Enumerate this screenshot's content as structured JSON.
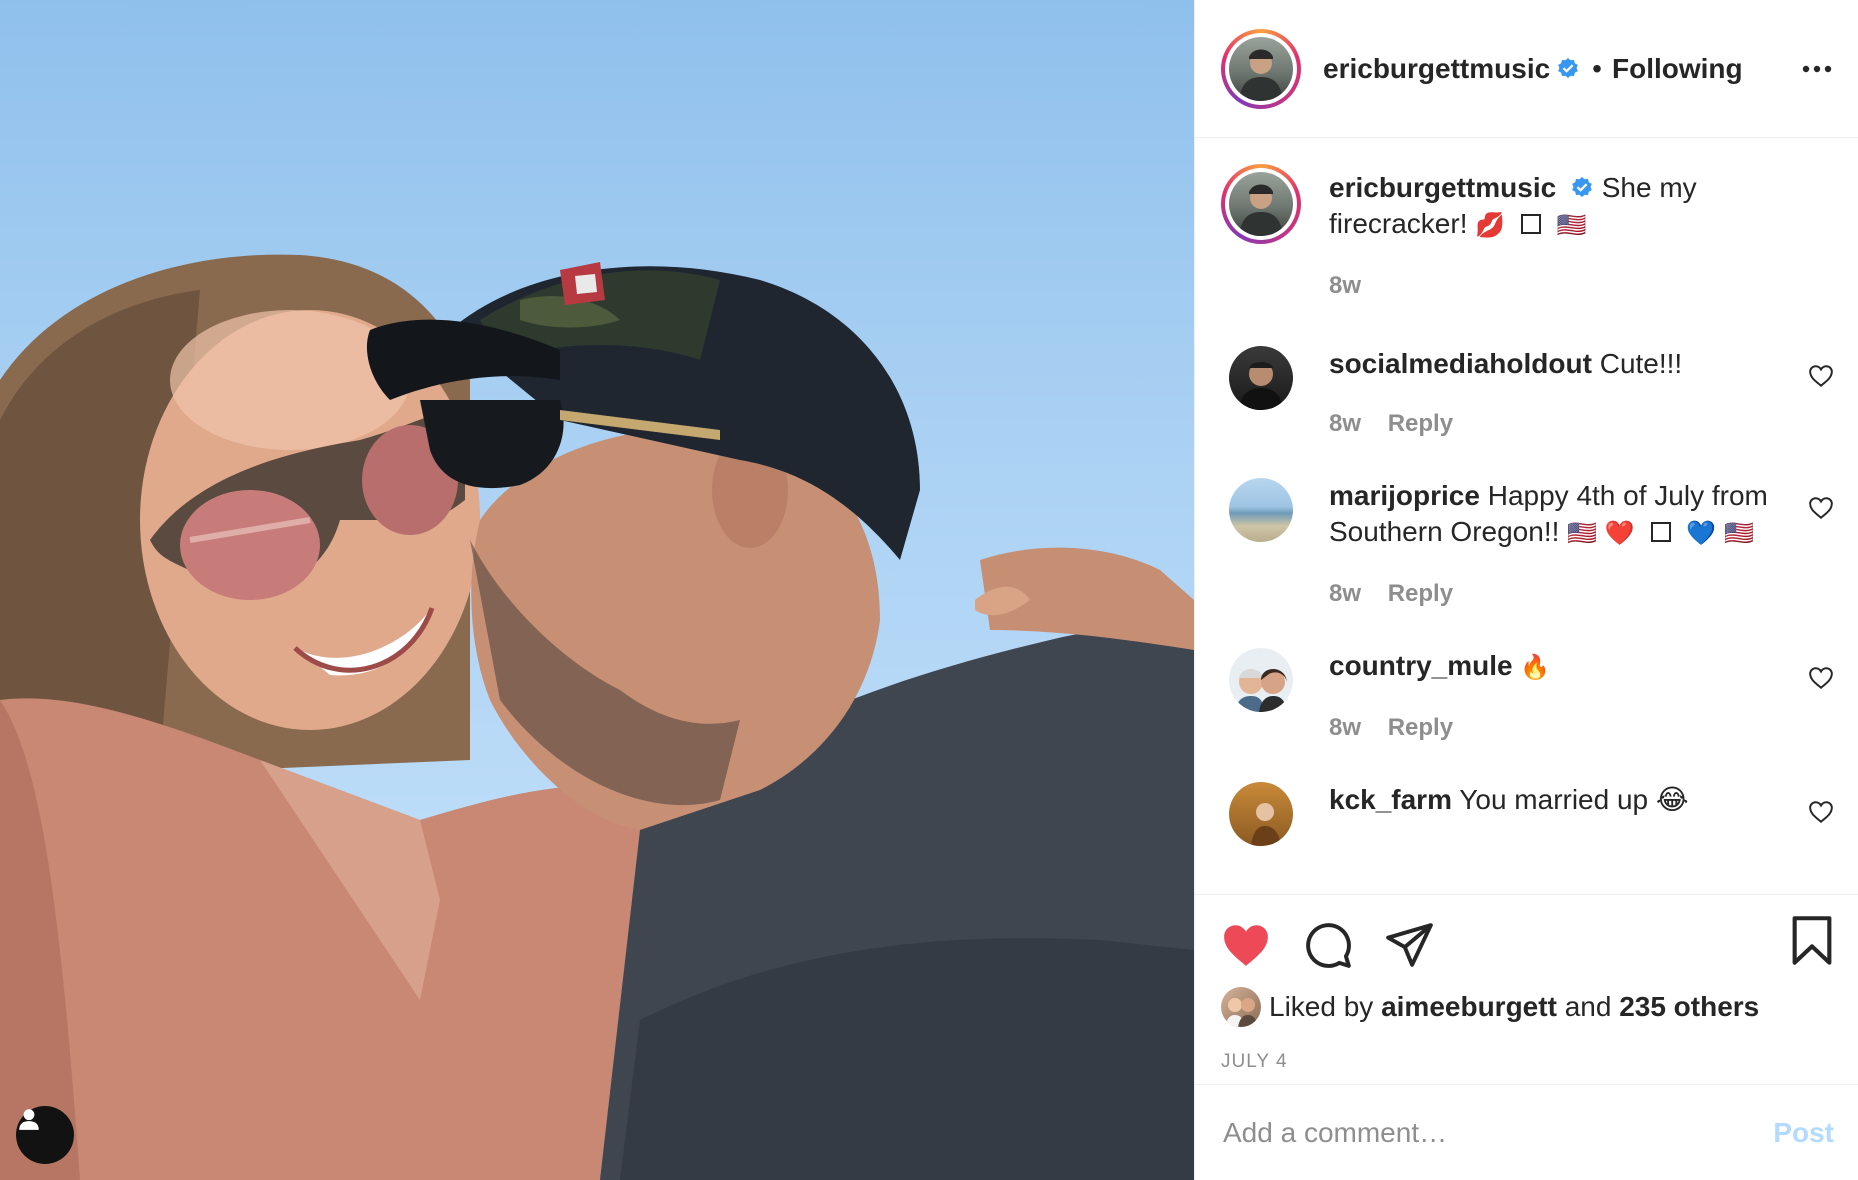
{
  "post": {
    "author": "ericburgettmusic",
    "author_verified": true,
    "follow_separator": "•",
    "follow_state": "Following",
    "more_icon": "more-horizontal-icon"
  },
  "caption": {
    "username": "ericburgettmusic",
    "text": "She my firecracker!",
    "emojis": [
      "💋",
      "□",
      "🇺🇸"
    ],
    "time": "8w"
  },
  "comments": [
    {
      "username": "socialmediaholdout",
      "text": "Cute!!!",
      "time": "8w",
      "reply": "Reply"
    },
    {
      "username": "marijoprice",
      "text": "Happy 4th of July from Southern Oregon!!",
      "emojis": [
        "🇺🇸",
        "❤️",
        "□",
        "💙",
        "🇺🇸"
      ],
      "time": "8w",
      "reply": "Reply"
    },
    {
      "username": "country_mule",
      "text": "🔥",
      "time": "8w",
      "reply": "Reply"
    },
    {
      "username": "kck_farm",
      "text": "You married up 😂",
      "time": "",
      "reply": ""
    }
  ],
  "actions": {
    "liked": true,
    "like_color": "#ed4956",
    "likes_prefix": "Liked by",
    "likes_user": "aimeeburgett",
    "likes_and": "and",
    "likes_others": "235 others",
    "date": "JULY 4"
  },
  "composer": {
    "placeholder": "Add a comment…",
    "post_label": "Post",
    "post_color": "#b3dbff"
  },
  "colors": {
    "verified": "#3897f0",
    "text": "#262626",
    "muted": "#8e8e8e"
  }
}
